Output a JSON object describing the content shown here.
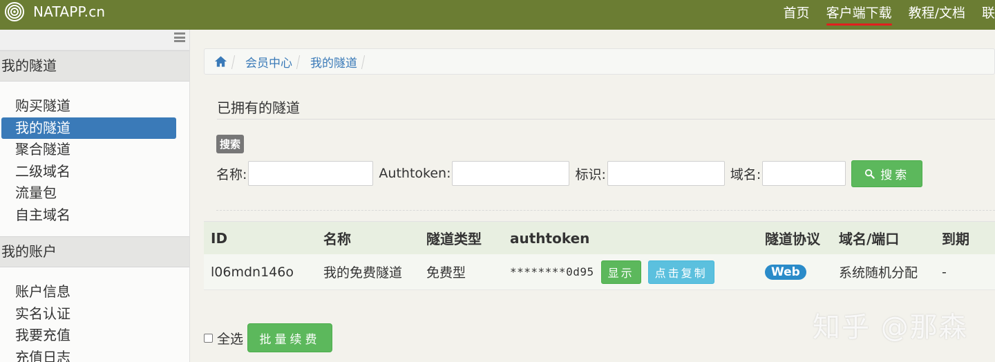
{
  "header": {
    "logo_text": "NATAPP.cn",
    "nav": [
      "首页",
      "客户端下载",
      "教程/文档",
      "联"
    ]
  },
  "sidebar": {
    "sections": [
      {
        "title": "我的隧道",
        "items": [
          "购买隧道",
          "我的隧道",
          "聚合隧道",
          "二级域名",
          "流量包",
          "自主域名"
        ]
      },
      {
        "title": "我的账户",
        "items": [
          "账户信息",
          "实名认证",
          "我要充值",
          "充值日志"
        ]
      }
    ]
  },
  "breadcrumb": [
    "会员中心",
    "我的隧道"
  ],
  "page": {
    "title": "已拥有的隧道",
    "search_badge": "搜索",
    "filters": {
      "name_label": "名称:",
      "authtoken_label": "Authtoken:",
      "tag_label": "标识:",
      "domain_label": "域名:",
      "name_value": "",
      "authtoken_value": "",
      "tag_value": "",
      "domain_value": ""
    },
    "search_button": "搜索"
  },
  "table": {
    "headers": [
      "ID",
      "名称",
      "隧道类型",
      "authtoken",
      "隧道协议",
      "域名/端口",
      "到期"
    ],
    "rows": [
      {
        "id": "l06mdn146o",
        "name": "我的免费隧道",
        "type": "免费型",
        "authtoken": "********0d95",
        "show_button": "显示",
        "copy_button": "点击复制",
        "protocol": "Web",
        "domain": "系统随机分配",
        "expire": "-"
      }
    ]
  },
  "footer_actions": {
    "select_all_label": "全选",
    "renew_button": "批量续费"
  },
  "watermark": "知乎 @那森",
  "colors": {
    "topbar": "#6b7d33",
    "active_item": "#3a7ab8",
    "success": "#5cb85c",
    "info": "#5bc0de",
    "badge_web": "#2a8bc9"
  }
}
